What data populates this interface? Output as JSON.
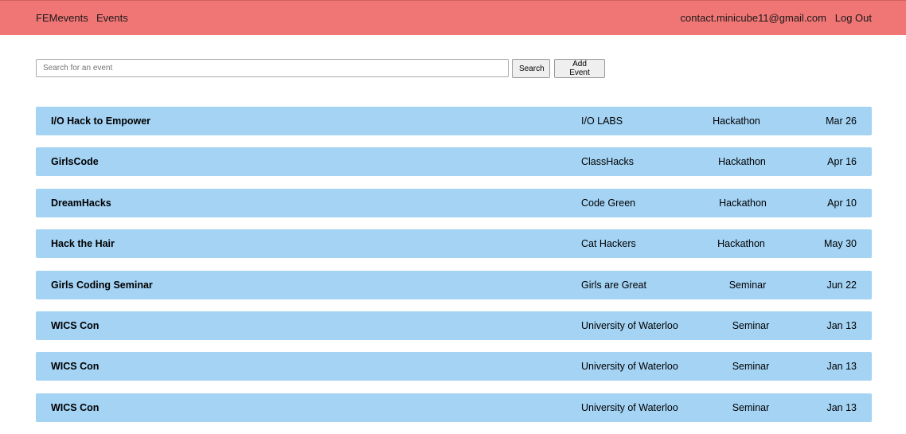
{
  "nav": {
    "brand": "FEMevents",
    "events_link": "Events",
    "user_email": "contact.minicube11@gmail.com",
    "logout": "Log Out"
  },
  "search": {
    "placeholder": "Search for an event",
    "value": "",
    "search_label": "Search",
    "add_label": "Add Event"
  },
  "events": [
    {
      "name": "I/O Hack to Empower",
      "org": "I/O LABS",
      "type": "Hackathon",
      "date": "Mar 26"
    },
    {
      "name": "GirlsCode",
      "org": "ClassHacks",
      "type": "Hackathon",
      "date": "Apr 16"
    },
    {
      "name": "DreamHacks",
      "org": "Code Green",
      "type": "Hackathon",
      "date": "Apr 10"
    },
    {
      "name": "Hack the Hair",
      "org": "Cat Hackers",
      "type": "Hackathon",
      "date": "May 30"
    },
    {
      "name": "Girls Coding Seminar",
      "org": "Girls are Great",
      "type": "Seminar",
      "date": "Jun 22"
    },
    {
      "name": "WICS Con",
      "org": "University of Waterloo",
      "type": "Seminar",
      "date": "Jan 13"
    },
    {
      "name": "WICS Con",
      "org": "University of Waterloo",
      "type": "Seminar",
      "date": "Jan 13"
    },
    {
      "name": "WICS Con",
      "org": "University of Waterloo",
      "type": "Seminar",
      "date": "Jan 13"
    }
  ],
  "colors": {
    "navbar": "#f07575",
    "event_row": "#a4d3f4"
  }
}
